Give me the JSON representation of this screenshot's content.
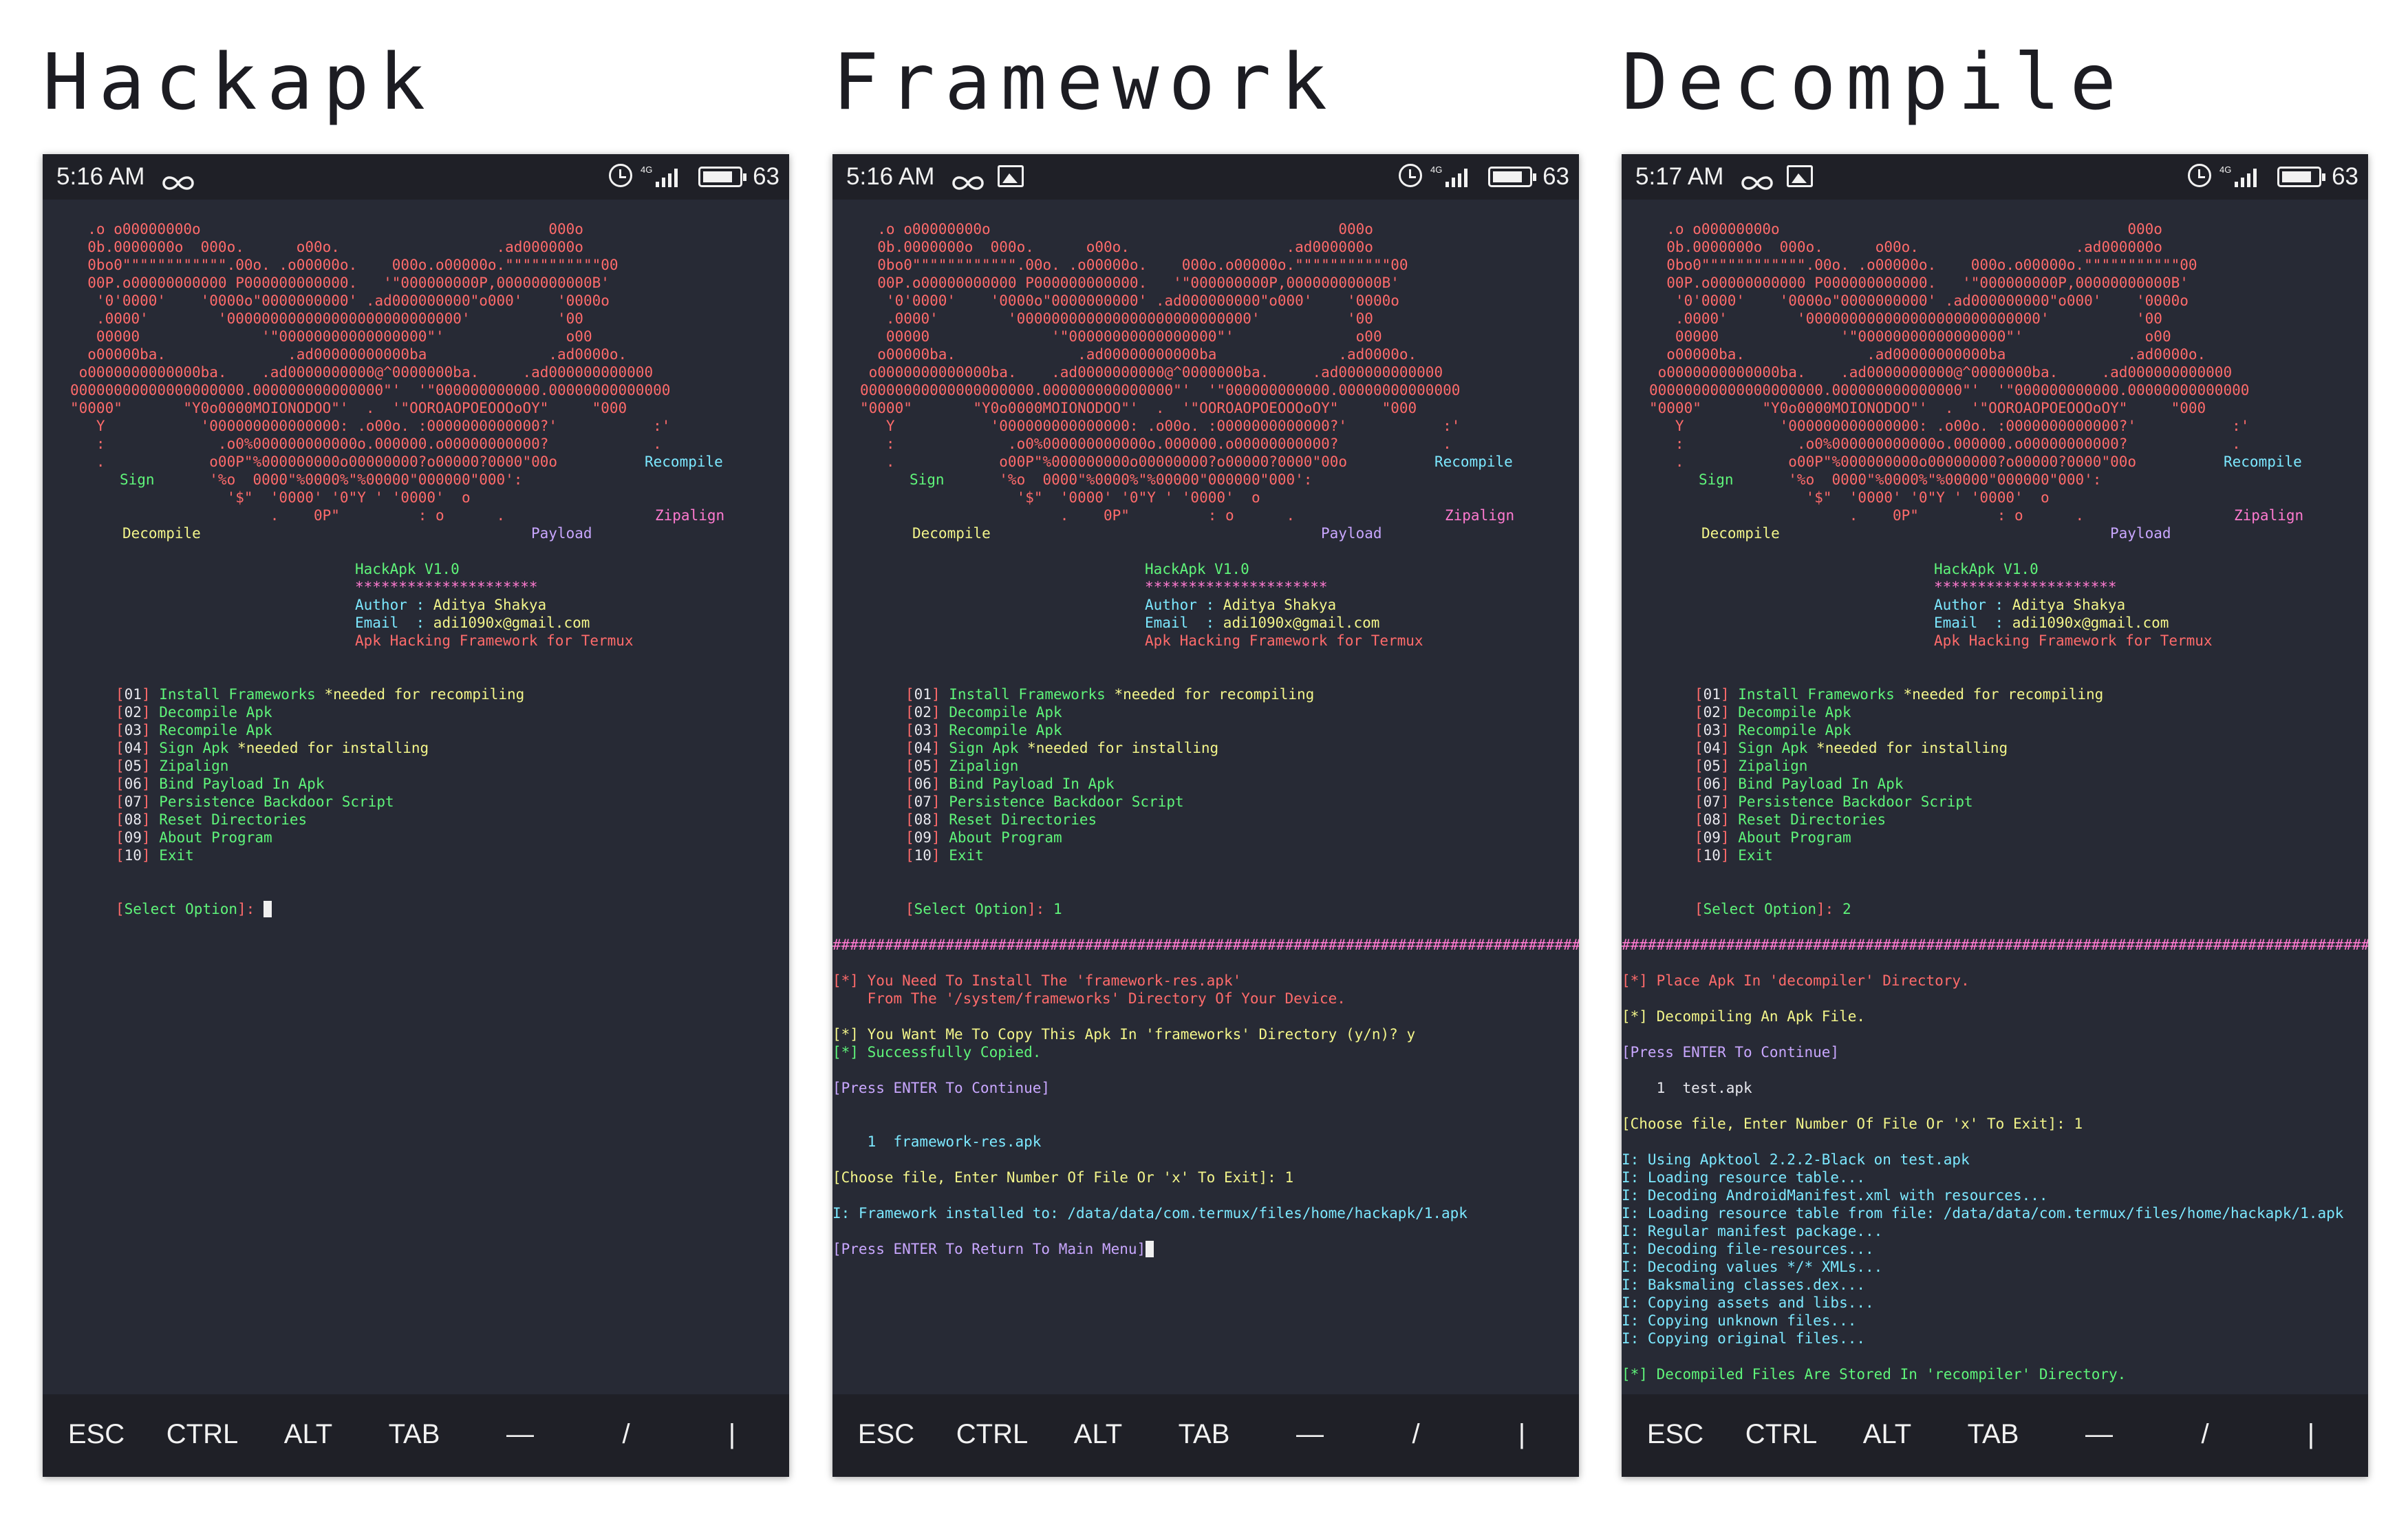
{
  "titles": [
    "Hackapk",
    "Framework",
    "Decompile"
  ],
  "statusbar": {
    "times": [
      "5:16 AM",
      "5:16 AM",
      "5:17 AM"
    ],
    "network": "4G",
    "battery": "63",
    "icons": [
      "infinity-link-icon",
      "image-notification-icon",
      "alarm-icon",
      "signal-icon",
      "battery-icon"
    ]
  },
  "keys": [
    "ESC",
    "CTRL",
    "ALT",
    "TAB",
    "—",
    "/",
    "|"
  ],
  "banner": {
    "art": [
      "  .o o00000000o                                        000o",
      "  0b.0000000o  000o.      o00o.                  .ad000000o",
      "  0bo0\"\"\"\"\"\"\"\"\"\"\"\".00o. .o00000o.    000o.o00000o.\"\"\"\"\"\"\"\"\"\"\"00",
      "  00P.o00000000000 P000000000000.   '\"000000000P,00000000000B'",
      "   '0'0000'    '0000o\"0000000000' .ad000000000\"o000'    '0000o",
      "   .0000'        '000000000000000000000000000'          '00",
      "   00000              '\"00000000000000000\"'              o00",
      "  o00000ba.              .ad00000000000ba              .ad0000o.",
      " o0000000000000ba.    .ad0000000000@^0000000ba.     .ad000000000000",
      "00000000000000000000.000000000000000\"'  '\"000000000000.00000000000000",
      "\"0000\"       \"Y0o0000MOIONODOO\"'  .  '\"OOROAOPOEOOOoOY\"     \"000",
      "   Y           '000000000000000: .o00o. :0000000000000?'           :'",
      "   :             .o0%000000000000o.000000.o00000000000?            .",
      "   .            o00P\"%000000000o00000000?o00000?0000\"00o"
    ],
    "art_tail": [
      "                '%o  0000\"%0000%\"%00000\"000000\"000':",
      "                  '$\"  '0000' '0\"Y ' '0000'  o",
      "                       .    0P\"         : o      ."
    ],
    "labels": {
      "sign": "Sign",
      "recompile": "Recompile",
      "zipalign": "Zipalign",
      "decompile": "Decompile",
      "payload": "Payload"
    },
    "info": {
      "name": "HackApk V1.0",
      "stars": "*********************",
      "author_label": "Author : ",
      "author": "Aditya Shakya",
      "email_label": "Email  : ",
      "email": "adi1090x@gmail.com",
      "tagline": "Apk Hacking Framework for Termux"
    }
  },
  "menu": [
    {
      "num": "01",
      "text": "Install Frameworks",
      "note": " *needed for recompiling"
    },
    {
      "num": "02",
      "text": "Decompile Apk",
      "note": ""
    },
    {
      "num": "03",
      "text": "Recompile Apk",
      "note": ""
    },
    {
      "num": "04",
      "text": "Sign Apk",
      "note": " *needed for installing"
    },
    {
      "num": "05",
      "text": "Zipalign",
      "note": ""
    },
    {
      "num": "06",
      "text": "Bind Payload In Apk",
      "note": ""
    },
    {
      "num": "07",
      "text": "Persistence Backdoor Script",
      "note": ""
    },
    {
      "num": "08",
      "text": "Reset Directories",
      "note": ""
    },
    {
      "num": "09",
      "text": "About Program",
      "note": ""
    },
    {
      "num": "10",
      "text": "Exit",
      "note": ""
    }
  ],
  "prompt_label": "Select Option",
  "selections": [
    "",
    "1",
    "2"
  ],
  "separator": "###############################################################################################",
  "framework_log": [
    {
      "cls": "c-red",
      "prefix": "[*]",
      "text": " You Need To Install The 'framework-res.apk'"
    },
    {
      "cls": "c-red",
      "prefix": "",
      "text": "    From The '/system/frameworks' Directory Of Your Device."
    },
    {
      "cls": "c-yellow",
      "prefix": "[*]",
      "text": " You Want Me To Copy This Apk In 'frameworks' Directory (y/n)? y"
    },
    {
      "cls": "c-green",
      "prefix": "[*]",
      "text": " Successfully Copied."
    },
    {
      "cls": "c-lilac",
      "prefix": "",
      "text": "[Press ENTER To Continue]"
    },
    {
      "cls": "c-cyan",
      "prefix": "",
      "text": "    1  framework-res.apk"
    },
    {
      "cls": "c-yellow",
      "prefix": "",
      "text": "[Choose file, Enter Number Of File Or 'x' To Exit]: 1"
    },
    {
      "cls": "c-cyan",
      "prefix": "",
      "text": "I: Framework installed to: /data/data/com.termux/files/home/hackapk/1.apk"
    },
    {
      "cls": "c-lilac",
      "prefix": "",
      "text": "[Press ENTER To Return To Main Menu]"
    }
  ],
  "decompile_log": [
    {
      "cls": "c-red",
      "text": "[*] Place Apk In 'decompiler' Directory."
    },
    {
      "cls": "c-yellow",
      "text": "[*] Decompiling An Apk File."
    },
    {
      "cls": "c-lilac",
      "text": "[Press ENTER To Continue]"
    },
    {
      "cls": "c-white",
      "text": "    1  test.apk"
    },
    {
      "cls": "c-yellow",
      "text": "[Choose file, Enter Number Of File Or 'x' To Exit]: 1"
    },
    {
      "cls": "c-cyan",
      "text": "I: Using Apktool 2.2.2-Black on test.apk"
    },
    {
      "cls": "c-cyan",
      "text": "I: Loading resource table..."
    },
    {
      "cls": "c-cyan",
      "text": "I: Decoding AndroidManifest.xml with resources..."
    },
    {
      "cls": "c-cyan",
      "text": "I: Loading resource table from file: /data/data/com.termux/files/home/hackapk/1.apk"
    },
    {
      "cls": "c-cyan",
      "text": "I: Regular manifest package..."
    },
    {
      "cls": "c-cyan",
      "text": "I: Decoding file-resources..."
    },
    {
      "cls": "c-cyan",
      "text": "I: Decoding values */* XMLs..."
    },
    {
      "cls": "c-cyan",
      "text": "I: Baksmaling classes.dex..."
    },
    {
      "cls": "c-cyan",
      "text": "I: Copying assets and libs..."
    },
    {
      "cls": "c-cyan",
      "text": "I: Copying unknown files..."
    },
    {
      "cls": "c-cyan",
      "text": "I: Copying original files..."
    },
    {
      "cls": "c-green",
      "text": "[*] Decompiled Files Are Stored In 'recompiler' Directory."
    }
  ],
  "colors": {
    "terminal_bg": "#272a35",
    "bar_bg": "#1f2027",
    "ascii_art": "#ff6b6b",
    "menu_text": "#5ff57a",
    "bracket": "#ff6b6b",
    "info": "#7ce8ff",
    "separator": "#ff7ad0"
  }
}
